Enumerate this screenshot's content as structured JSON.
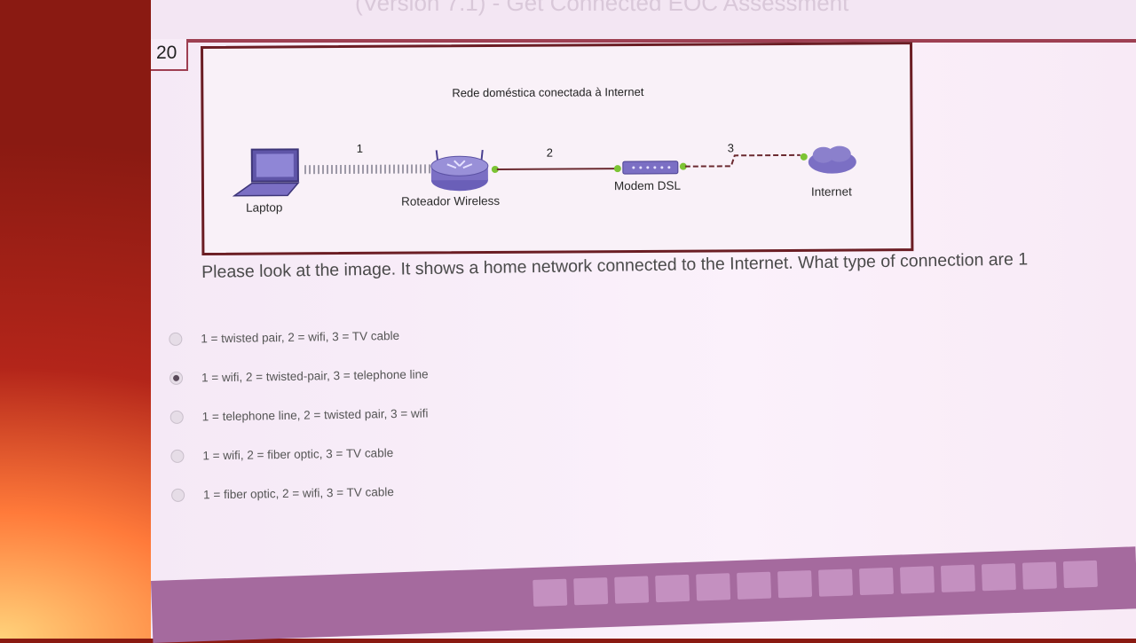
{
  "header": {
    "title": "(Version 7.1) - Get Connected EOC Assessment"
  },
  "question": {
    "number": "20",
    "text": "Please look at the image. It shows a home network connected to the Internet. What type of connection are 1"
  },
  "diagram": {
    "title": "Rede doméstica conectada à Internet",
    "devices": {
      "laptop": "Laptop",
      "router": "Roteador Wireless",
      "modem": "Modem DSL",
      "internet": "Internet"
    },
    "link_labels": [
      "1",
      "2",
      "3"
    ]
  },
  "options": [
    {
      "label": "1 = twisted pair, 2 = wifi, 3 = TV cable",
      "selected": false
    },
    {
      "label": "1 = wifi, 2 = twisted-pair, 3 = telephone line",
      "selected": true
    },
    {
      "label": "1 = telephone line, 2 = twisted pair, 3 = wifi",
      "selected": false
    },
    {
      "label": "1 = wifi, 2 = fiber optic, 3 = TV cable",
      "selected": false
    },
    {
      "label": "1 = fiber optic, 2 = wifi, 3 = TV cable",
      "selected": false
    }
  ],
  "colors": {
    "device_purple": "#7b6fc4",
    "connector_green": "#7cc434",
    "frame_red": "#6b1d24"
  }
}
